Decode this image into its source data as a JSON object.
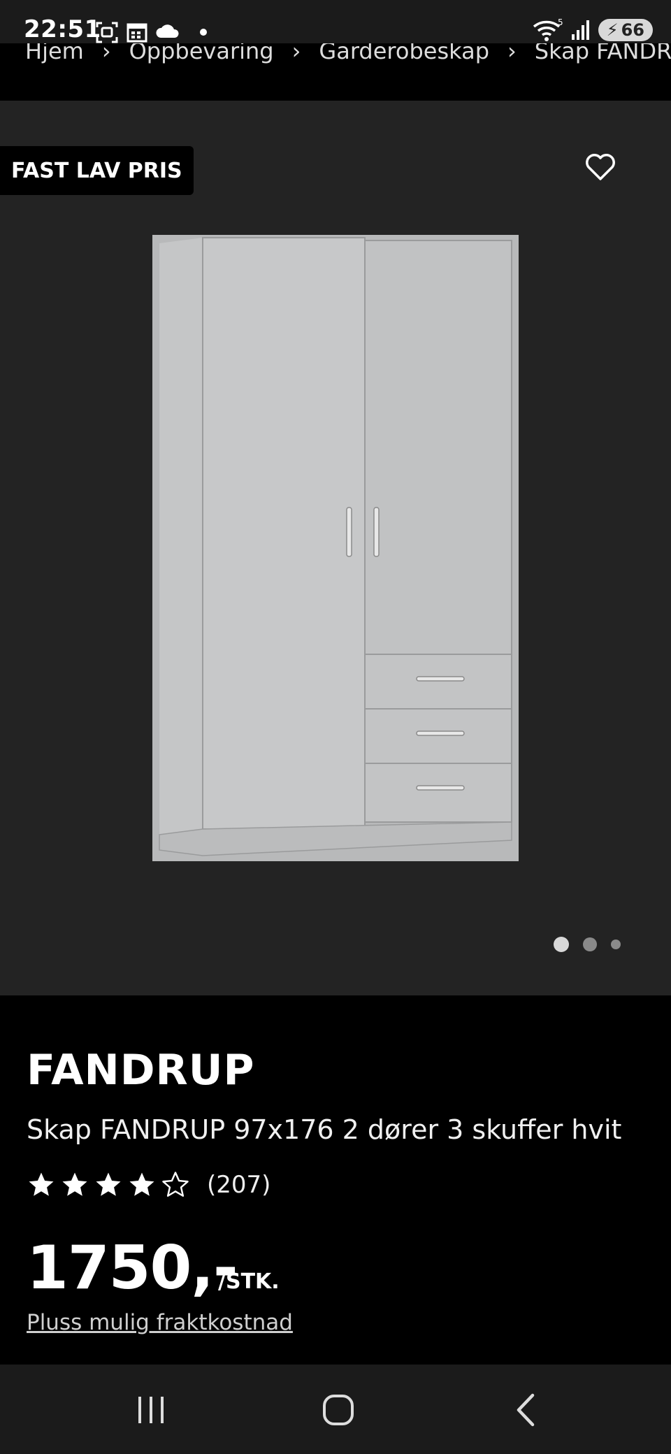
{
  "status_bar": {
    "time": "22:51",
    "battery": "66",
    "icons": [
      "screenshot-icon",
      "calendar-icon",
      "cloud-icon",
      "dot-icon",
      "wifi-icon",
      "signal-icon",
      "battery-icon"
    ]
  },
  "breadcrumb": {
    "items": [
      "Hjem",
      "Oppbevaring",
      "Garderobeskap",
      "Skap FANDRUP"
    ]
  },
  "gallery": {
    "badge": "FAST LAV PRIS",
    "favorite_icon": "heart-icon",
    "image_count": 3,
    "active_index": 0
  },
  "product": {
    "brand": "FANDRUP",
    "description": "Skap FANDRUP 97x176 2 dører 3 skuffer hvit",
    "rating": 4,
    "rating_max": 5,
    "review_count": "(207)",
    "price": "1750,-",
    "unit": "/STK.",
    "shipping_link": "Pluss mulig fraktkostnad"
  },
  "navigation": {
    "icons": [
      "recent-apps-icon",
      "home-icon",
      "back-icon"
    ]
  },
  "colors": {
    "background": "#000000",
    "gallery_bg": "#232323",
    "statusbar_bg": "#1b1b1b",
    "text": "#ffffff"
  }
}
